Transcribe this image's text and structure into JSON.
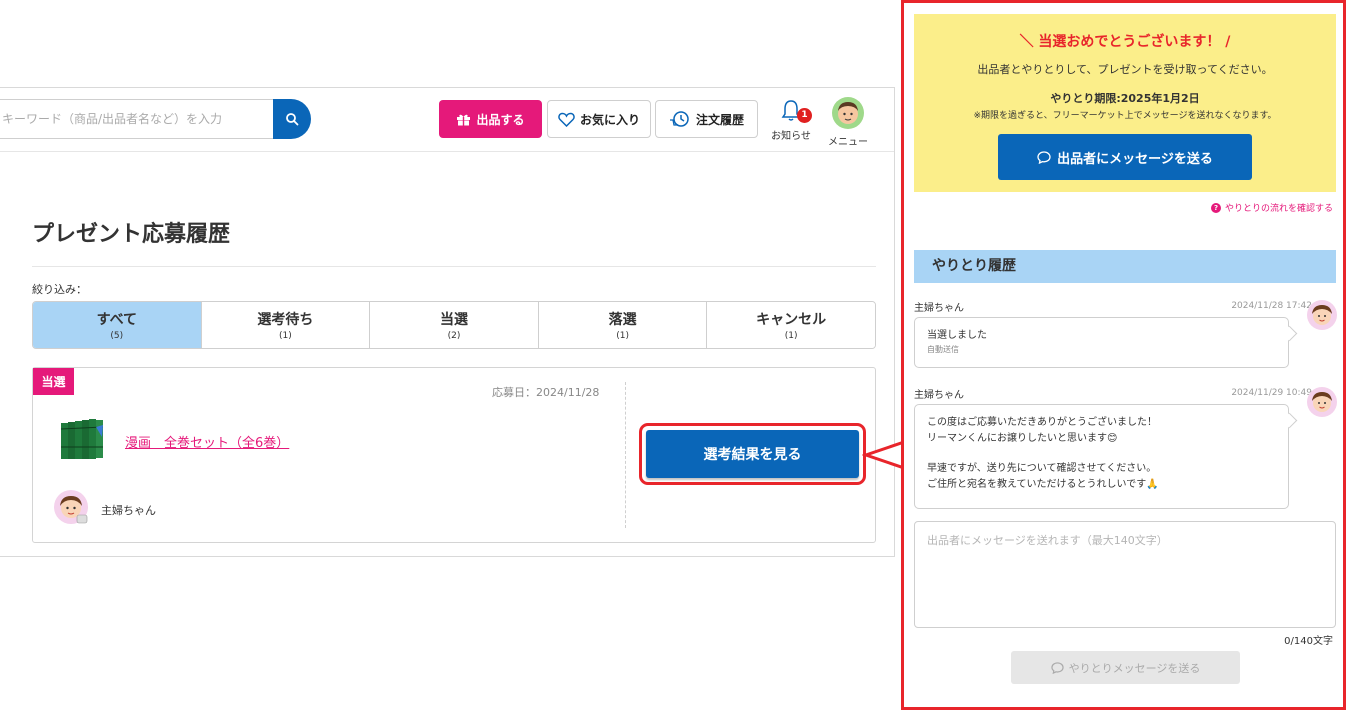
{
  "header": {
    "search_placeholder": "キーワード（商品/出品者名など）を入力",
    "sell_label": "出品する",
    "favorites_label": "お気に入り",
    "orders_label": "注文履歴",
    "notice_label": "お知らせ",
    "notice_count": "1",
    "menu_label": "メニュー"
  },
  "page": {
    "title": "プレゼント応募履歴",
    "filter_label": "絞り込み：",
    "tabs": [
      {
        "label": "すべて",
        "count": "(5)",
        "active": true
      },
      {
        "label": "選考待ち",
        "count": "(1)"
      },
      {
        "label": "当選",
        "count": "(2)"
      },
      {
        "label": "落選",
        "count": "(1)"
      },
      {
        "label": "キャンセル",
        "count": "(1)"
      }
    ]
  },
  "entry": {
    "status": "当選",
    "date": "応募日：2024/11/28",
    "item_title": "漫画　全巻セット（全6巻）",
    "seller_name": "主婦ちゃん",
    "result_button": "選考結果を見る"
  },
  "panel": {
    "congrats_heading": "＼ 当選おめでとうございます！ /",
    "congrats_message": "出品者とやりとりして、プレゼントを受け取ってください。",
    "deadline": "やりとり期限:2025年1月2日",
    "deadline_note": "※期限を過ぎると、フリーマーケット上でメッセージを送れなくなります。",
    "send_to_seller": "出品者にメッセージを送る",
    "flow_link": "やりとりの流れを確認する",
    "history_heading": "やりとり履歴",
    "messages": [
      {
        "author": "主婦ちゃん",
        "time": "2024/11/28 17:42",
        "text": "当選しました",
        "sub": "自動送信"
      },
      {
        "author": "主婦ちゃん",
        "time": "2024/11/29 10:49",
        "line1": "この度はご応募いただきありがとうございました！",
        "line2": "リーマンくんにお譲りしたいと思います😊",
        "line3": "早速ですが、送り先について確認させてください。",
        "line4": "ご住所と宛名を教えていただけるとうれしいです🙏"
      }
    ],
    "reply_placeholder": "出品者にメッセージを送れます（最大140文字）",
    "char_counter": "0/140文字",
    "send_reply": "やりとりメッセージを送る"
  },
  "colors": {
    "accent_blue": "#0a66b8",
    "accent_pink": "#e5197a",
    "highlight_red": "#e8252b",
    "light_blue": "#a9d4f5",
    "yellow": "#fbee8a"
  }
}
